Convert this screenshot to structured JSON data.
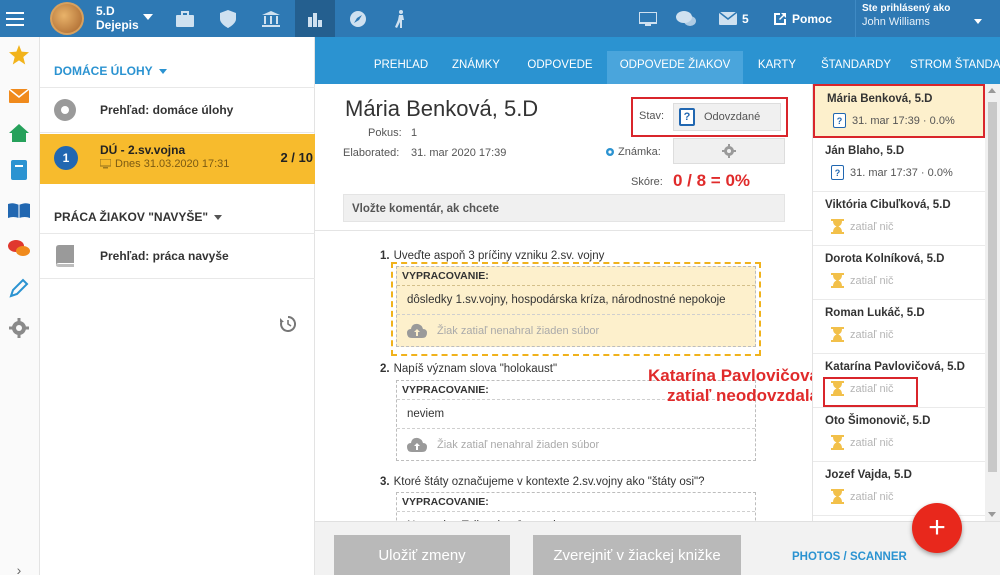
{
  "header": {
    "class_name": "5.D",
    "subject": "Dejepis",
    "messages_count": "5",
    "help": "Pomoc",
    "logged_in_label": "Ste prihlásený ako",
    "user_name": "John Williams"
  },
  "left": {
    "homework_section": "DOMÁCE ÚLOHY",
    "overview_homework": "Prehľad: domáce úlohy",
    "active_item": {
      "number": "1",
      "title": "DÚ - 2.sv.vojna",
      "date": "Dnes 31.03.2020 17:31",
      "count": "2 / 10"
    },
    "extra_section": "PRÁCA ŽIAKOV \"NAVYŠE\"",
    "overview_extra": "Prehľad: práca navyše"
  },
  "tabs": [
    "PREHĽAD",
    "ZNÁMKY",
    "ODPOVEDE",
    "ODPOVEDE ŽIAKOV",
    "KARTY",
    "ŠTANDARDY",
    "STROM ŠTANDARDOV"
  ],
  "main": {
    "student": "Mária Benková, 5.D",
    "attempt_label": "Pokus:",
    "attempt_value": "1",
    "elaborated_label": "Elaborated:",
    "elaborated_value": "31. mar 2020 17:39",
    "status_label": "Stav:",
    "status_value": "Odovzdané",
    "grade_label": "Známka:",
    "score_label": "Skóre:",
    "score_value": "0 / 8 = 0%",
    "comment_placeholder": "Vložte komentár, ak chcete"
  },
  "questions": [
    {
      "n": "1.",
      "text": "Uveďte aspoň 3 príčiny vzniku 2.sv. vojny",
      "label": "VYPRACOVANIE:",
      "answer": "dôsledky 1.sv.vojny, hospodárska kríza, národnostné nepokoje",
      "upload": "Žiak zatiaľ nenahral žiaden súbor"
    },
    {
      "n": "2.",
      "text": "Napíš význam slova \"holokaust\"",
      "label": "VYPRACOVANIE:",
      "answer": "neviem",
      "upload": "Žiak zatiaľ nenahral žiaden súbor"
    },
    {
      "n": "3.",
      "text": "Ktoré štáty označujeme v kontexte 2.sv.vojny ako \"štáty osi\"?",
      "label": "VYPRACOVANIE:",
      "answer": "Nemecko, Taliansko, Japonsko"
    }
  ],
  "annotation": {
    "line1": "Katarína Pavlovičová",
    "line2": "zatiaľ neodovzdala"
  },
  "bottom": {
    "save": "Uložiť zmeny",
    "publish": "Zverejniť v žiackej knižke",
    "photos": "PHOTOS / SCANNER",
    "fab": "+"
  },
  "students": [
    {
      "name": "Mária Benková, 5.D",
      "status": "31. mar 17:39 · 0.0%",
      "type": "submitted"
    },
    {
      "name": "Ján Blaho, 5.D",
      "status": "31. mar 17:37 · 0.0%",
      "type": "submitted"
    },
    {
      "name": "Viktória Cibuľková, 5.D",
      "status": "zatiaľ nič",
      "type": "none"
    },
    {
      "name": "Dorota Kolníková, 5.D",
      "status": "zatiaľ nič",
      "type": "none"
    },
    {
      "name": "Roman Lukáč, 5.D",
      "status": "zatiaľ nič",
      "type": "none"
    },
    {
      "name": "Katarína Pavlovičová, 5.D",
      "status": "zatiaľ nič",
      "type": "none"
    },
    {
      "name": "Oto Šimonovič, 5.D",
      "status": "zatiaľ nič",
      "type": "none"
    },
    {
      "name": "Jozef Vajda, 5.D",
      "status": "zatiaľ nič",
      "type": "none"
    }
  ],
  "colors": {
    "topbar": "#2e79b4",
    "tabs": "#2b93d1",
    "active_item": "#f7bb2d",
    "highlight": "#fdf0cc",
    "alert_red": "#e02b2b"
  }
}
